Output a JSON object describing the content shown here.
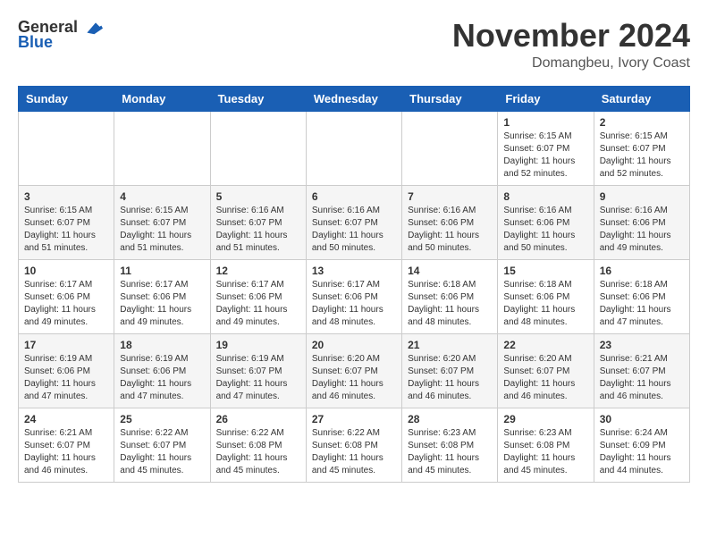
{
  "header": {
    "logo_general": "General",
    "logo_blue": "Blue",
    "month_title": "November 2024",
    "location": "Domangbeu, Ivory Coast"
  },
  "days_of_week": [
    "Sunday",
    "Monday",
    "Tuesday",
    "Wednesday",
    "Thursday",
    "Friday",
    "Saturday"
  ],
  "weeks": [
    {
      "days": [
        {
          "date": "",
          "info": ""
        },
        {
          "date": "",
          "info": ""
        },
        {
          "date": "",
          "info": ""
        },
        {
          "date": "",
          "info": ""
        },
        {
          "date": "",
          "info": ""
        },
        {
          "date": "1",
          "info": "Sunrise: 6:15 AM\nSunset: 6:07 PM\nDaylight: 11 hours\nand 52 minutes."
        },
        {
          "date": "2",
          "info": "Sunrise: 6:15 AM\nSunset: 6:07 PM\nDaylight: 11 hours\nand 52 minutes."
        }
      ]
    },
    {
      "days": [
        {
          "date": "3",
          "info": "Sunrise: 6:15 AM\nSunset: 6:07 PM\nDaylight: 11 hours\nand 51 minutes."
        },
        {
          "date": "4",
          "info": "Sunrise: 6:15 AM\nSunset: 6:07 PM\nDaylight: 11 hours\nand 51 minutes."
        },
        {
          "date": "5",
          "info": "Sunrise: 6:16 AM\nSunset: 6:07 PM\nDaylight: 11 hours\nand 51 minutes."
        },
        {
          "date": "6",
          "info": "Sunrise: 6:16 AM\nSunset: 6:07 PM\nDaylight: 11 hours\nand 50 minutes."
        },
        {
          "date": "7",
          "info": "Sunrise: 6:16 AM\nSunset: 6:06 PM\nDaylight: 11 hours\nand 50 minutes."
        },
        {
          "date": "8",
          "info": "Sunrise: 6:16 AM\nSunset: 6:06 PM\nDaylight: 11 hours\nand 50 minutes."
        },
        {
          "date": "9",
          "info": "Sunrise: 6:16 AM\nSunset: 6:06 PM\nDaylight: 11 hours\nand 49 minutes."
        }
      ]
    },
    {
      "days": [
        {
          "date": "10",
          "info": "Sunrise: 6:17 AM\nSunset: 6:06 PM\nDaylight: 11 hours\nand 49 minutes."
        },
        {
          "date": "11",
          "info": "Sunrise: 6:17 AM\nSunset: 6:06 PM\nDaylight: 11 hours\nand 49 minutes."
        },
        {
          "date": "12",
          "info": "Sunrise: 6:17 AM\nSunset: 6:06 PM\nDaylight: 11 hours\nand 49 minutes."
        },
        {
          "date": "13",
          "info": "Sunrise: 6:17 AM\nSunset: 6:06 PM\nDaylight: 11 hours\nand 48 minutes."
        },
        {
          "date": "14",
          "info": "Sunrise: 6:18 AM\nSunset: 6:06 PM\nDaylight: 11 hours\nand 48 minutes."
        },
        {
          "date": "15",
          "info": "Sunrise: 6:18 AM\nSunset: 6:06 PM\nDaylight: 11 hours\nand 48 minutes."
        },
        {
          "date": "16",
          "info": "Sunrise: 6:18 AM\nSunset: 6:06 PM\nDaylight: 11 hours\nand 47 minutes."
        }
      ]
    },
    {
      "days": [
        {
          "date": "17",
          "info": "Sunrise: 6:19 AM\nSunset: 6:06 PM\nDaylight: 11 hours\nand 47 minutes."
        },
        {
          "date": "18",
          "info": "Sunrise: 6:19 AM\nSunset: 6:06 PM\nDaylight: 11 hours\nand 47 minutes."
        },
        {
          "date": "19",
          "info": "Sunrise: 6:19 AM\nSunset: 6:07 PM\nDaylight: 11 hours\nand 47 minutes."
        },
        {
          "date": "20",
          "info": "Sunrise: 6:20 AM\nSunset: 6:07 PM\nDaylight: 11 hours\nand 46 minutes."
        },
        {
          "date": "21",
          "info": "Sunrise: 6:20 AM\nSunset: 6:07 PM\nDaylight: 11 hours\nand 46 minutes."
        },
        {
          "date": "22",
          "info": "Sunrise: 6:20 AM\nSunset: 6:07 PM\nDaylight: 11 hours\nand 46 minutes."
        },
        {
          "date": "23",
          "info": "Sunrise: 6:21 AM\nSunset: 6:07 PM\nDaylight: 11 hours\nand 46 minutes."
        }
      ]
    },
    {
      "days": [
        {
          "date": "24",
          "info": "Sunrise: 6:21 AM\nSunset: 6:07 PM\nDaylight: 11 hours\nand 46 minutes."
        },
        {
          "date": "25",
          "info": "Sunrise: 6:22 AM\nSunset: 6:07 PM\nDaylight: 11 hours\nand 45 minutes."
        },
        {
          "date": "26",
          "info": "Sunrise: 6:22 AM\nSunset: 6:08 PM\nDaylight: 11 hours\nand 45 minutes."
        },
        {
          "date": "27",
          "info": "Sunrise: 6:22 AM\nSunset: 6:08 PM\nDaylight: 11 hours\nand 45 minutes."
        },
        {
          "date": "28",
          "info": "Sunrise: 6:23 AM\nSunset: 6:08 PM\nDaylight: 11 hours\nand 45 minutes."
        },
        {
          "date": "29",
          "info": "Sunrise: 6:23 AM\nSunset: 6:08 PM\nDaylight: 11 hours\nand 45 minutes."
        },
        {
          "date": "30",
          "info": "Sunrise: 6:24 AM\nSunset: 6:09 PM\nDaylight: 11 hours\nand 44 minutes."
        }
      ]
    }
  ]
}
